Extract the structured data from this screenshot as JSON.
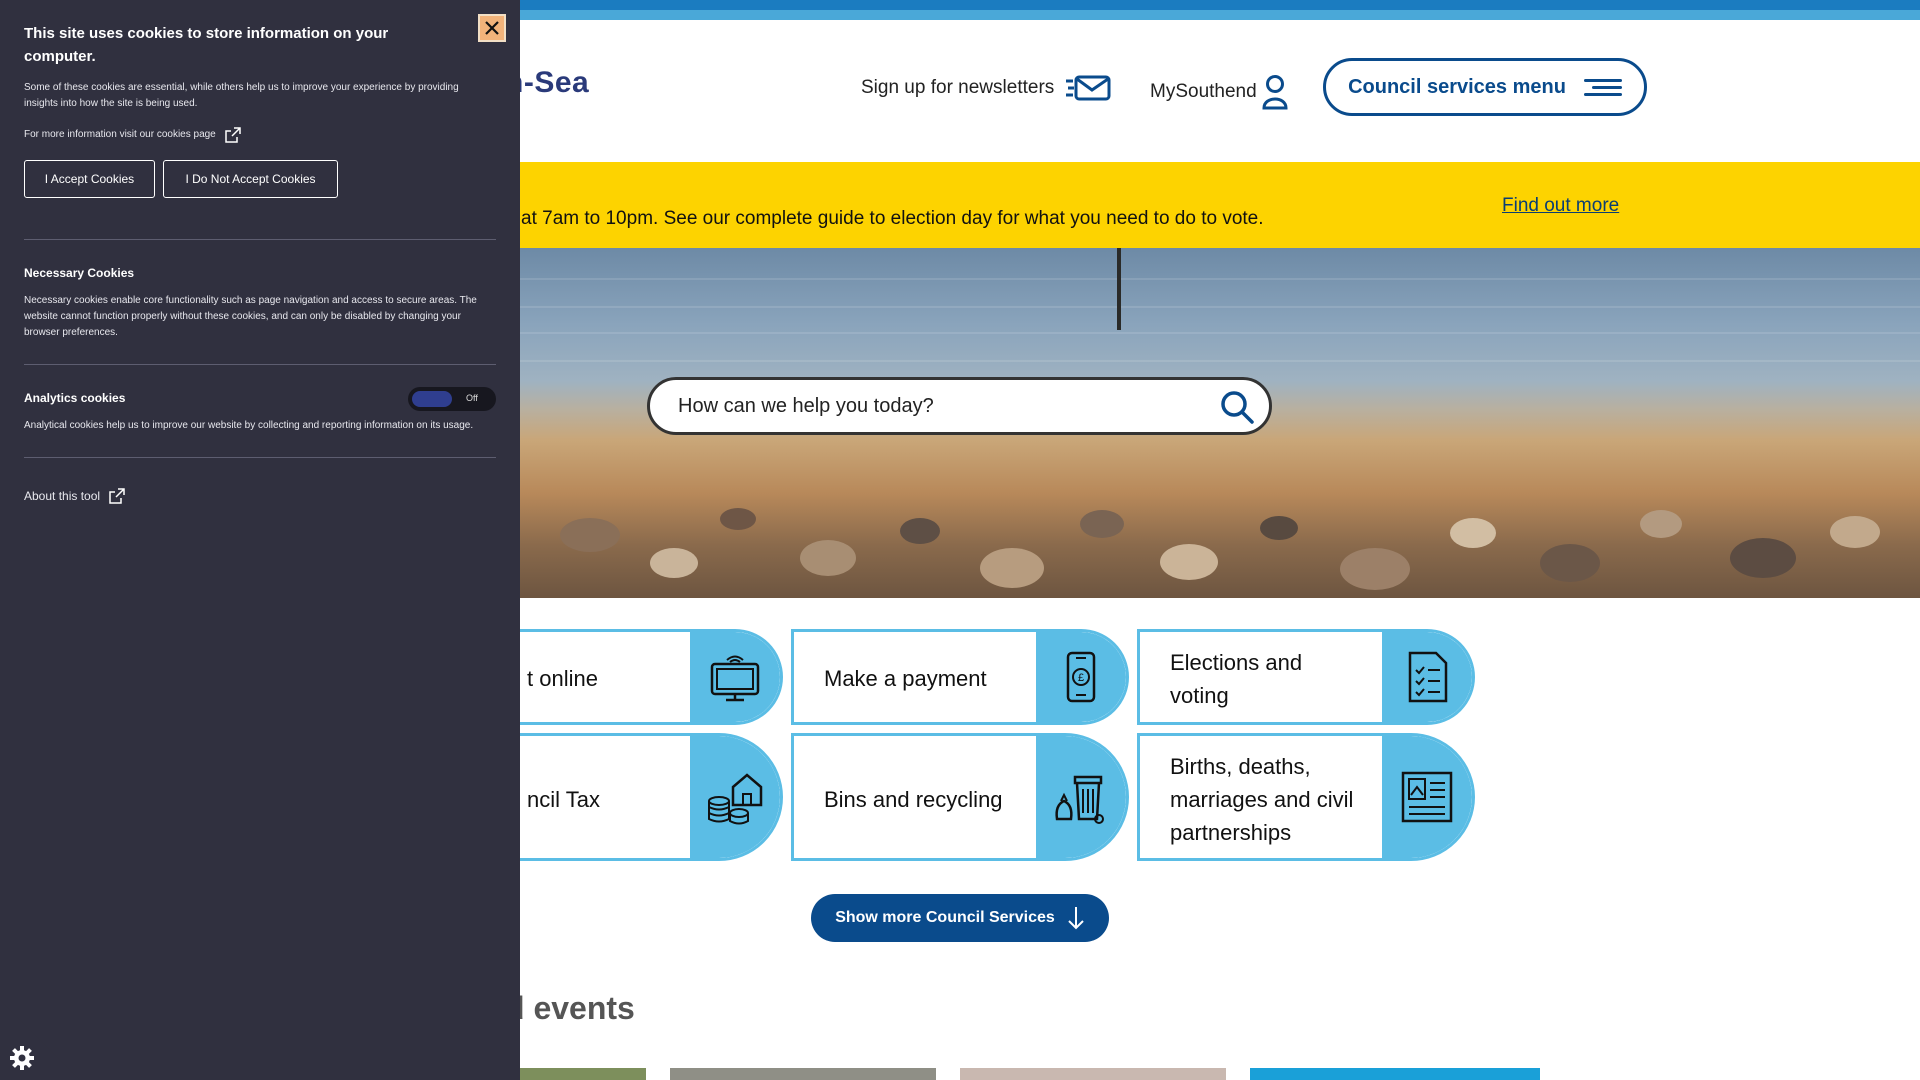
{
  "header": {
    "logo_partial": "n-Sea",
    "newsletter_label": "Sign up for newsletters",
    "mysouthend_label": "MySouthend",
    "menu_label": "Council services menu"
  },
  "alert": {
    "text": "at 7am to 10pm. See our complete guide to election day for what you need to do to vote.",
    "link": "Find out more"
  },
  "search": {
    "placeholder": "How can we help you today?"
  },
  "services": {
    "tiles": [
      {
        "label": "t online",
        "icon": "computer-icon"
      },
      {
        "label": "Make a payment",
        "icon": "phone-payment-icon"
      },
      {
        "label": "Elections and voting",
        "icon": "checklist-icon"
      },
      {
        "label": "ncil Tax",
        "icon": "house-coins-icon"
      },
      {
        "label": "Bins and recycling",
        "icon": "bins-icon"
      },
      {
        "label": "Births, deaths, marriages and civil partnerships",
        "icon": "document-icon"
      }
    ],
    "more_button": "Show more Council Services"
  },
  "events": {
    "heading": "d events"
  },
  "cookie_panel": {
    "title": "This site uses cookies to store information on your computer.",
    "intro": "Some of these cookies are essential, while others help us to improve your experience by providing insights into how the site is being used.",
    "more_info": "For more information visit our cookies page",
    "accept_button": "I Accept Cookies",
    "reject_button": "I Do Not Accept Cookies",
    "necessary_title": "Necessary Cookies",
    "necessary_text": "Necessary cookies enable core functionality such as page navigation and access to secure areas. The website cannot function properly without these cookies, and can only be disabled by changing your browser preferences.",
    "analytics_title": "Analytics cookies",
    "analytics_state": "Off",
    "analytics_text": "Analytical cookies help us to improve our website by collecting and reporting information on its usage.",
    "about_tool": "About this tool"
  },
  "colors": {
    "brand_blue": "#0a4b8c",
    "tile_blue": "#5bbde5",
    "alert_yellow": "#fdd300",
    "cookie_bg": "#30303f"
  }
}
